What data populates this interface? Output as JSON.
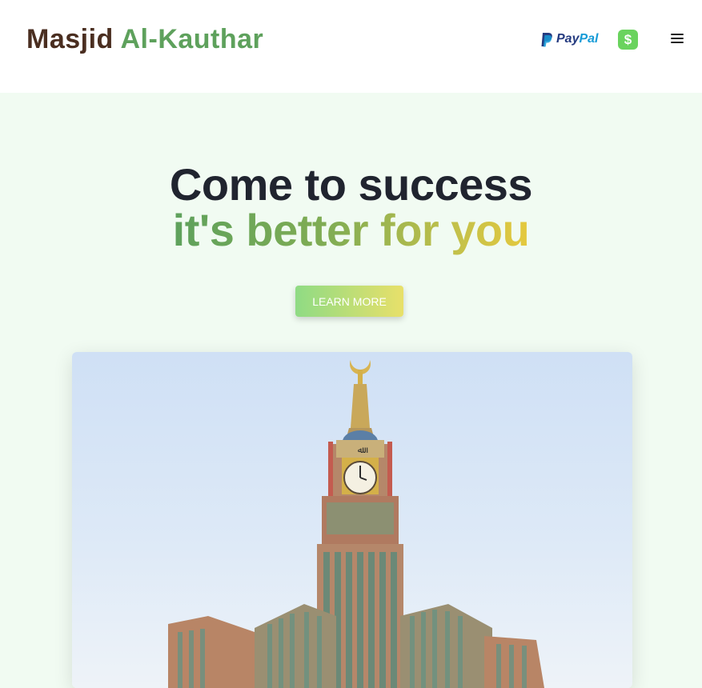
{
  "header": {
    "brand_part1": "Masjid",
    "brand_part2": "Al-Kauthar",
    "paypal_pay": "Pay",
    "paypal_pal": "Pal",
    "cashapp_symbol": "$",
    "menu_icon": "hamburger-icon"
  },
  "hero": {
    "title_line1": "Come to success",
    "title_line2": "it's better for you",
    "cta_label": "LEARN MORE",
    "image_subject": "clock-tower-image"
  },
  "colors": {
    "brand_dark": "#4a2e20",
    "brand_green": "#5ea15c",
    "background": "#f1fbf2",
    "gradient_start": "#8fdb84",
    "gradient_end": "#e8e06a",
    "heading": "#20242f"
  }
}
